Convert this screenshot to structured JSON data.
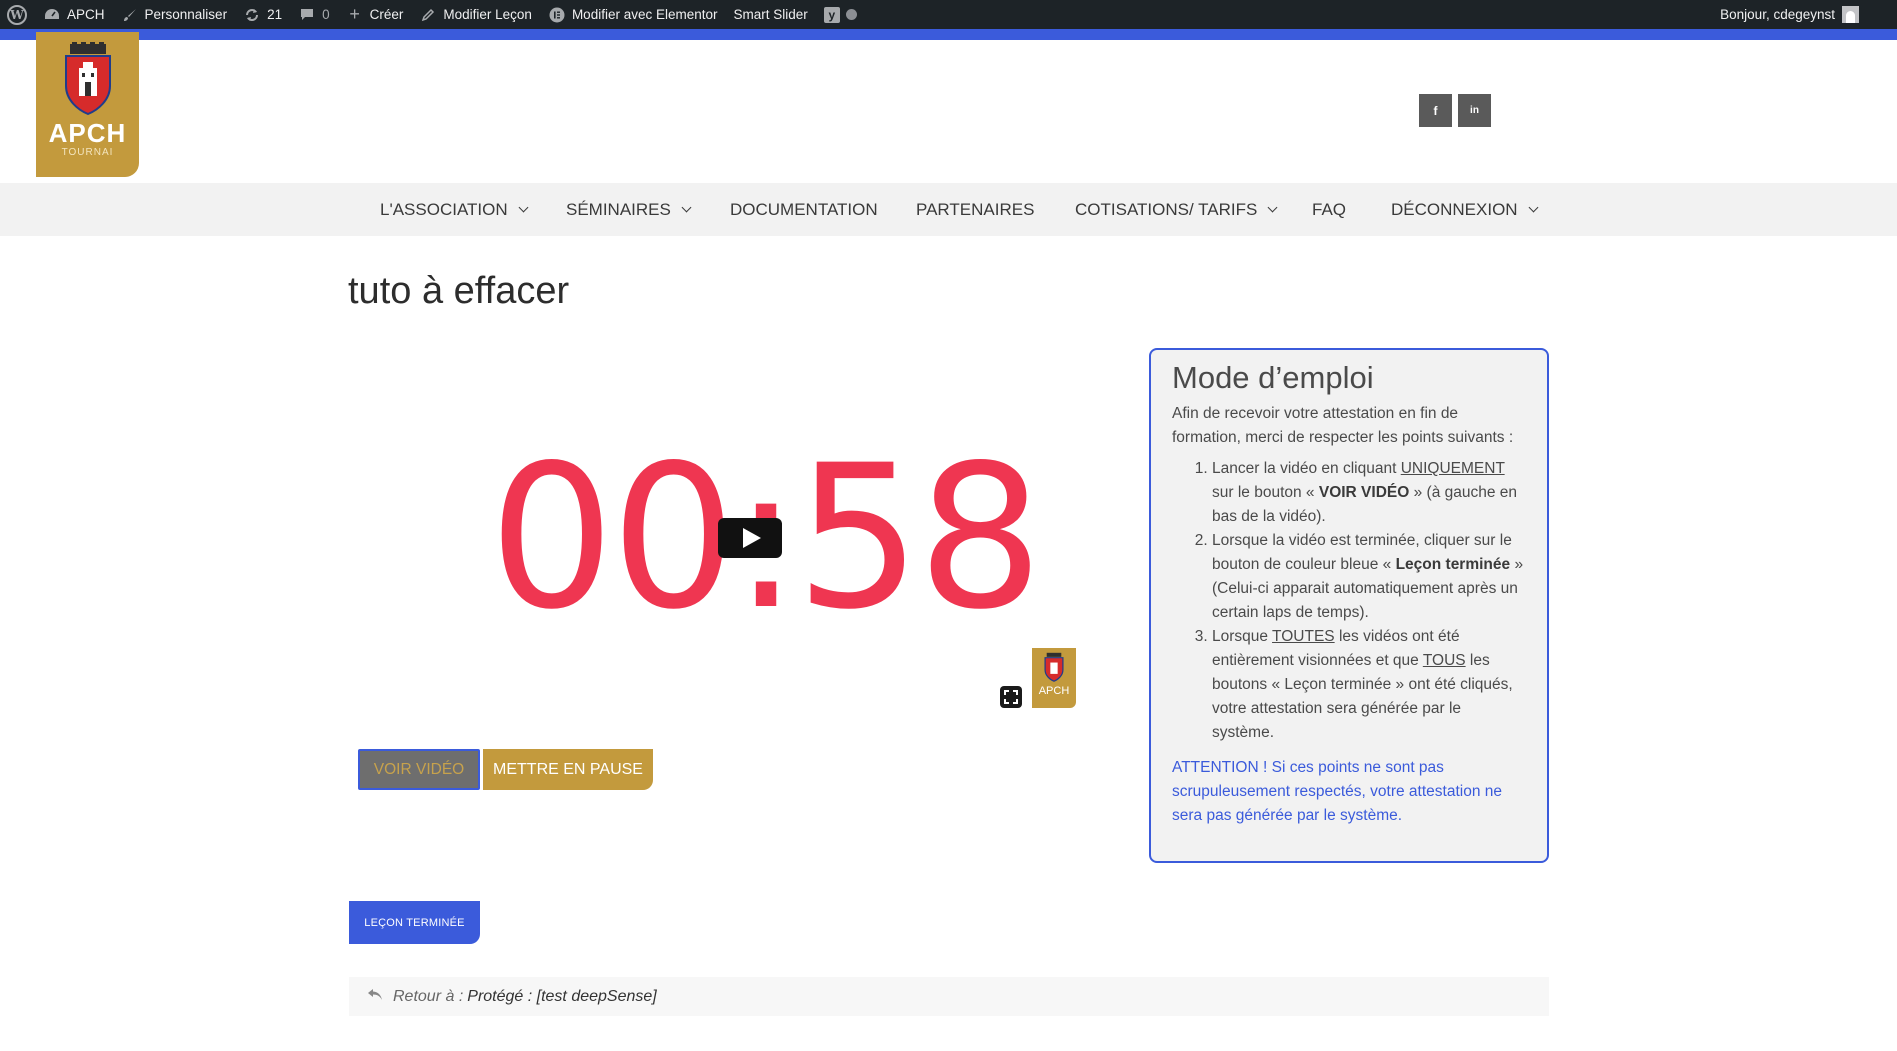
{
  "adminbar": {
    "site_name": "APCH",
    "customize": "Personnaliser",
    "updates_count": "21",
    "comments_count": "0",
    "new": "Créer",
    "edit_lesson": "Modifier Leçon",
    "edit_elementor": "Modifier avec Elementor",
    "smart_slider": "Smart Slider",
    "greeting": "Bonjour, cdegeynst"
  },
  "logo": {
    "title": "APCH",
    "subtitle": "TOURNAI"
  },
  "social": {
    "facebook": "f",
    "linkedin": "in"
  },
  "nav": {
    "items": [
      {
        "label": "L'ASSOCIATION",
        "dropdown": true
      },
      {
        "label": "SÉMINAIRES",
        "dropdown": true
      },
      {
        "label": "DOCUMENTATION",
        "dropdown": false
      },
      {
        "label": "PARTENAIRES",
        "dropdown": false
      },
      {
        "label": "COTISATIONS/ TARIFS",
        "dropdown": true
      },
      {
        "label": "FAQ",
        "dropdown": false
      },
      {
        "label": "DÉCONNEXION",
        "dropdown": true
      }
    ]
  },
  "page": {
    "title": "tuto à effacer"
  },
  "video": {
    "countdown_minutes": "00",
    "countdown_seconds": "58",
    "colon": ":",
    "watermark": "APCH"
  },
  "buttons": {
    "voir_video": "VOIR VIDÉO",
    "pause": "METTRE EN PAUSE",
    "lecon_terminee": "LEÇON TERMINÉE"
  },
  "panel": {
    "title": "Mode d’emploi",
    "intro": "Afin de recevoir votre attestation en fin de formation, merci de respecter les points suivants :",
    "attention": "ATTENTION ! Si ces points ne sont pas scrupuleusement respectés, votre attestation ne sera pas générée par le système."
  },
  "retour": {
    "label": "Retour à :",
    "link": "Protégé : [test deepSense]"
  },
  "colors": {
    "accent_blue": "#3b5bdb",
    "brand_gold": "#c39a3d",
    "countdown_red": "#ef3651",
    "adminbar_bg": "#1d2327"
  }
}
